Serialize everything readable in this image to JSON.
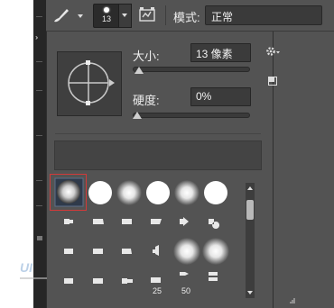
{
  "options_bar": {
    "brush_tool_icon": "brush-icon",
    "brush_size_value": "13",
    "mode_label": "模式:",
    "mode_value": "正常"
  },
  "brush_panel": {
    "size_label": "大小:",
    "size_value": "13 像素",
    "size_slider_fraction": 0.02,
    "hardness_label": "硬度:",
    "hardness_value": "0%",
    "hardness_slider_fraction": 0.0,
    "gear_icon": "gear-icon",
    "new_preset_icon": "new-preset-icon"
  },
  "preset_grid": {
    "selected_index": 0,
    "labels": [
      "25",
      "50"
    ]
  },
  "colors": {
    "panel_bg": "#535353",
    "field_bg": "#3b3b3b",
    "selection": "#d03a3a"
  }
}
